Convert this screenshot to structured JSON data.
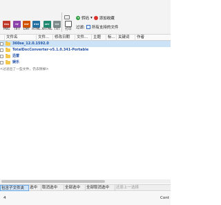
{
  "toolbar": {
    "formats": [
      {
        "label": "PNG",
        "color": "#c0392b",
        "tag": "PNG"
      },
      {
        "label": "TIFF",
        "color": "#8e44ad",
        "tag": "TIF"
      },
      {
        "label": "EMF",
        "color": "#d35400",
        "tag": "EMF"
      },
      {
        "label": "HTML",
        "color": "#2471a3",
        "tag": "HTM"
      },
      {
        "label": "XHTML",
        "color": "#1f8a70",
        "tag": "XHT"
      },
      {
        "label": "TXT",
        "color": "#7f8c8d",
        "tag": "TXT"
      }
    ],
    "print_label": "打印",
    "convert_label": "转码",
    "convert_arrow": "▾",
    "add_favorites_label": "添加收藏",
    "filter_label": "过滤:",
    "all_files_label": "所有支持的文件"
  },
  "columns": [
    "文件名",
    "文件...",
    "修改日期",
    "文件...",
    "主题",
    "标...",
    "关键词",
    "作者"
  ],
  "rows": [
    {
      "name": "360se_12.0.1592.0",
      "selected": true,
      "style": "blue"
    },
    {
      "name": "TotalDocConverter-v5.1.0.341-Portable",
      "selected": false,
      "style": "blue"
    },
    {
      "name": "迅雷",
      "selected": false,
      "style": "blue"
    },
    {
      "name": "娱乐",
      "selected": false,
      "style": "blue"
    }
  ],
  "hint": "<过滤出了一些文件，仍去除掉>",
  "bottom_buttons": [
    {
      "label": "包含子文件夹",
      "active": true,
      "disabled": false
    },
    {
      "label": "选中",
      "active": false,
      "disabled": false
    },
    {
      "label": "取消选中",
      "active": false,
      "disabled": false
    },
    {
      "label": "全部选中",
      "active": false,
      "disabled": false
    },
    {
      "label": "全部取消选中",
      "active": false,
      "disabled": false
    },
    {
      "label": "还原上一选择",
      "active": false,
      "disabled": true
    }
  ],
  "status": {
    "count": "4",
    "right_text": "Cont"
  }
}
